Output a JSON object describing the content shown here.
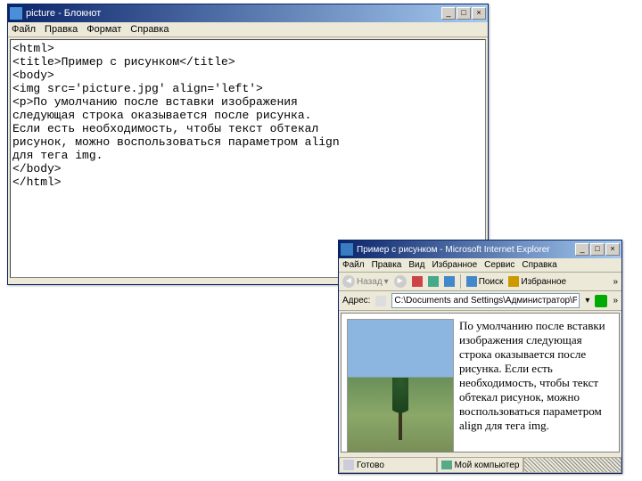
{
  "notepad": {
    "title": "picture - Блокнот",
    "menu": {
      "file": "Файл",
      "edit": "Правка",
      "format": "Формат",
      "help": "Справка"
    },
    "code": "<html>\n<title>Пример с рисунком</title>\n<body>\n<img src='picture.jpg' align='left'>\n<p>По умолчанию после вставки изображения\nследующая строка оказывается после рисунка.\nЕсли есть необходимость, чтобы текст обтекал\nрисунок, можно воспользоваться параметром align\nдля тега img.\n</body>\n</html>"
  },
  "ie": {
    "title": "Пример с рисунком - Microsoft Internet Explorer",
    "menu": {
      "file": "Файл",
      "edit": "Правка",
      "view": "Вид",
      "fav": "Избранное",
      "tools": "Сервис",
      "help": "Справка"
    },
    "toolbar": {
      "back": "Назад",
      "search": "Поиск",
      "fav": "Избранное"
    },
    "addr": {
      "label": "Адрес:",
      "value": "C:\\Documents and Settings\\Администратор\\Рабочий сто"
    },
    "page": "По умолчанию после вставки изображения следующая строка оказывается после рисунка. Если есть необходимость, чтобы текст обтекал рисунок, можно воспользоваться параметром align для тега img.",
    "status": {
      "done": "Готово",
      "zone": "Мой компьютер"
    }
  },
  "winbtns": {
    "min": "_",
    "max": "□",
    "close": "×"
  }
}
